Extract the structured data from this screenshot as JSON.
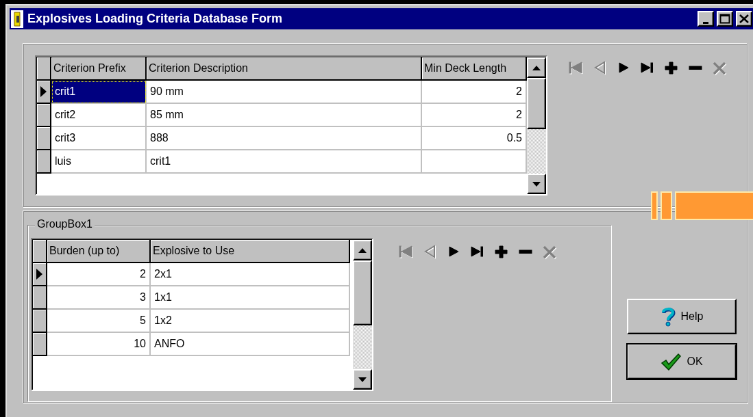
{
  "window": {
    "title": "Explosives Loading Criteria Database Form"
  },
  "criteria_grid": {
    "focused": true,
    "columns": [
      {
        "label": "Criterion Prefix"
      },
      {
        "label": "Criterion Description"
      },
      {
        "label": "Min Deck Length"
      }
    ],
    "rows": [
      {
        "selected": true,
        "cells": [
          "crit1",
          "90 mm",
          "2"
        ]
      },
      {
        "selected": false,
        "cells": [
          "crit2",
          "85 mm",
          "2"
        ]
      },
      {
        "selected": false,
        "cells": [
          "crit3",
          "888",
          "0.5"
        ]
      },
      {
        "selected": false,
        "cells": [
          "luis",
          "crit1",
          null
        ]
      }
    ]
  },
  "criteria_navigator": [
    {
      "kind": "first",
      "disabled": true
    },
    {
      "kind": "prior",
      "disabled": true
    },
    {
      "kind": "next",
      "disabled": false
    },
    {
      "kind": "last",
      "disabled": false
    },
    {
      "kind": "insert",
      "disabled": false
    },
    {
      "kind": "delete",
      "disabled": false
    },
    {
      "kind": "cancel",
      "disabled": true
    }
  ],
  "groupbox": {
    "title": "GroupBox1",
    "grid": {
      "focused": false,
      "columns": [
        {
          "label": "Burden (up to)"
        },
        {
          "label": "Explosive to Use"
        }
      ],
      "rows": [
        {
          "selected": true,
          "cells": [
            "2",
            "2x1"
          ]
        },
        {
          "selected": false,
          "cells": [
            "3",
            "1x1"
          ]
        },
        {
          "selected": false,
          "cells": [
            "5",
            "1x2"
          ]
        },
        {
          "selected": false,
          "cells": [
            "10",
            "ANFO"
          ]
        }
      ]
    },
    "navigator": [
      {
        "kind": "first",
        "disabled": true
      },
      {
        "kind": "prior",
        "disabled": true
      },
      {
        "kind": "next",
        "disabled": false
      },
      {
        "kind": "last",
        "disabled": false
      },
      {
        "kind": "insert",
        "disabled": false
      },
      {
        "kind": "delete",
        "disabled": false
      },
      {
        "kind": "cancel",
        "disabled": true
      }
    ]
  },
  "buttons": [
    {
      "kind": "help",
      "label": "Help",
      "default": false
    },
    {
      "kind": "ok",
      "label": "OK",
      "default": true
    }
  ]
}
